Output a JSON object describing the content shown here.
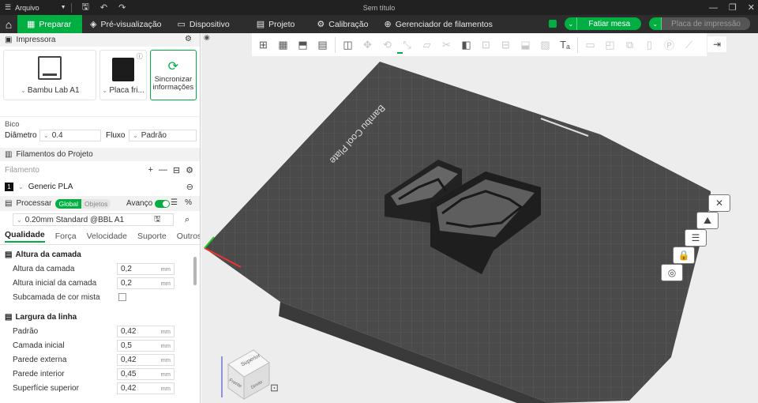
{
  "titlebar": {
    "menu_label": "Arquivo",
    "window_title": "Sem título"
  },
  "nav": {
    "tabs": [
      {
        "label": "Preparar",
        "icon": "prepare-icon",
        "active": true
      },
      {
        "label": "Pré-visualização",
        "icon": "preview-icon",
        "active": false
      },
      {
        "label": "Dispositivo",
        "icon": "device-icon",
        "active": false
      },
      {
        "label": "Projeto",
        "icon": "project-icon",
        "active": false
      },
      {
        "label": "Calibração",
        "icon": "calibration-icon",
        "active": false
      },
      {
        "label": "Gerenciador de filamentos",
        "icon": "filament-manager-icon",
        "active": false
      }
    ],
    "slice_label": "Fatiar mesa",
    "print_label": "Placa de impressão"
  },
  "printer": {
    "section_title": "Impressora",
    "printer_name": "Bambu Lab A1",
    "plate_name": "Placa fri...",
    "sync_label_1": "Sincronizar",
    "sync_label_2": "informações",
    "nozzle_title": "Bico",
    "diameter_label": "Diâmetro",
    "diameter_value": "0.4",
    "flow_label": "Fluxo",
    "flow_value": "Padrão"
  },
  "filaments": {
    "section_title": "Filamentos do Projeto",
    "filament_label": "Filamento",
    "items": [
      {
        "index": "1",
        "name": "Generic PLA"
      }
    ]
  },
  "process": {
    "section_title": "Processar",
    "seg_global": "Global",
    "seg_objects": "Objetos",
    "advanced_label": "Avanço",
    "profile": "0.20mm Standard @BBL A1",
    "tabs": [
      "Qualidade",
      "Força",
      "Velocidade",
      "Suporte",
      "Outros"
    ],
    "groups": [
      {
        "title": "Altura da camada",
        "rows": [
          {
            "label": "Altura da camada",
            "value": "0,2",
            "unit": "mm"
          },
          {
            "label": "Altura inicial da camada",
            "value": "0,2",
            "unit": "mm"
          },
          {
            "label": "Subcamada de cor mista",
            "checkbox": true
          }
        ]
      },
      {
        "title": "Largura da linha",
        "rows": [
          {
            "label": "Padrão",
            "value": "0,42",
            "unit": "mm"
          },
          {
            "label": "Camada inicial",
            "value": "0,5",
            "unit": "mm"
          },
          {
            "label": "Parede externa",
            "value": "0,42",
            "unit": "mm"
          },
          {
            "label": "Parede interior",
            "value": "0,45",
            "unit": "mm"
          },
          {
            "label": "Superfície superior",
            "value": "0,42",
            "unit": "mm"
          }
        ]
      }
    ]
  },
  "viewport": {
    "plate_text": "Bambu Cool Plate",
    "cube_top": "Superior",
    "cube_front": "Frente",
    "cube_right": "Direito",
    "accent": "#00ae42"
  }
}
